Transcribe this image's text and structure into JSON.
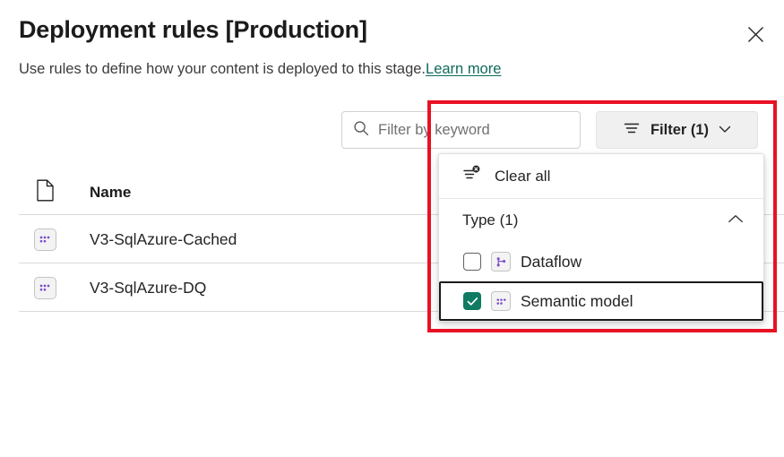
{
  "header": {
    "title": "Deployment rules [Production]",
    "subtitle": "Use rules to define how your content is deployed to this stage.",
    "learn_more_label": "Learn more",
    "close_label": "Close"
  },
  "toolbar": {
    "search_placeholder": "Filter by keyword",
    "search_value": "",
    "filter_button_label": "Filter (1)"
  },
  "table": {
    "columns": {
      "icon_header": "",
      "name_header": "Name"
    },
    "rows": [
      {
        "name": "V3-SqlAzure-Cached",
        "type_icon": "semantic-model-icon"
      },
      {
        "name": "V3-SqlAzure-DQ",
        "type_icon": "semantic-model-icon"
      }
    ]
  },
  "filter_flyout": {
    "clear_all_label": "Clear all",
    "group_title": "Type (1)",
    "group_expanded": true,
    "options": [
      {
        "label": "Dataflow",
        "checked": false,
        "icon": "dataflow-icon"
      },
      {
        "label": "Semantic model",
        "checked": true,
        "icon": "semantic-model-icon"
      }
    ]
  },
  "colors": {
    "accent_teal": "#107a63",
    "link_teal": "#0f6b5c",
    "icon_purple": "#7b4fc9",
    "annotation_red": "#e81123",
    "divider": "#d9d9d9"
  }
}
